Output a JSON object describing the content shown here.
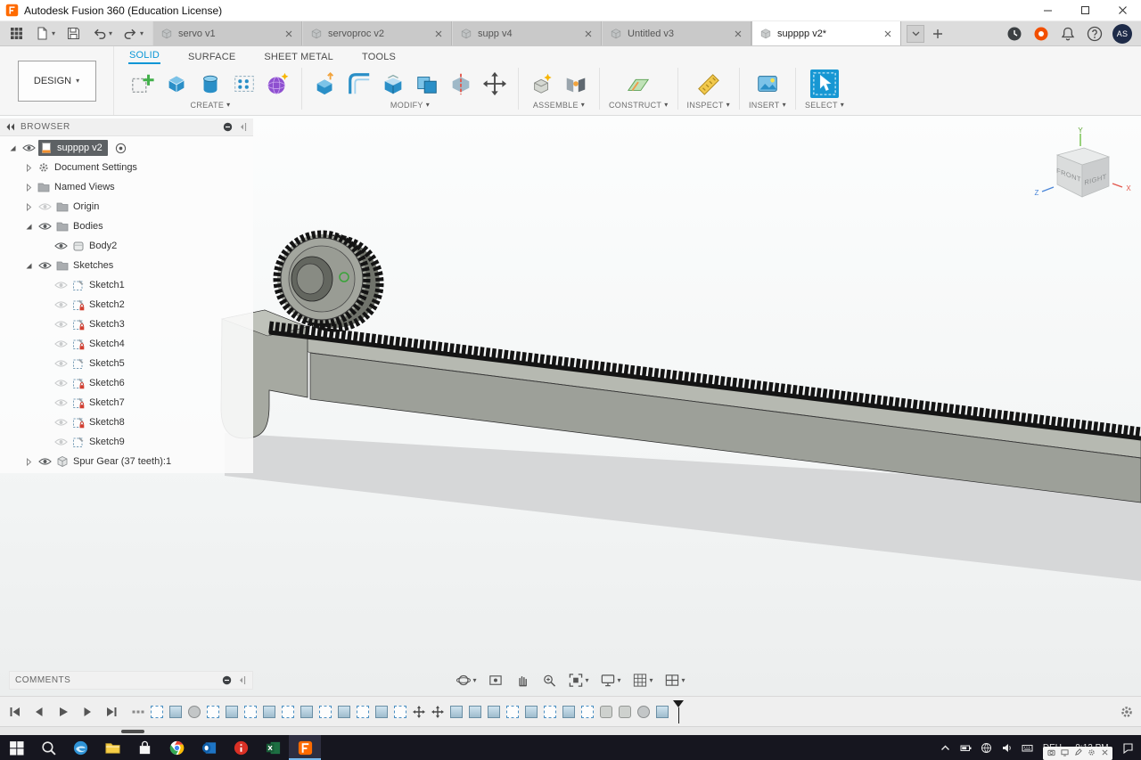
{
  "titlebar": {
    "title": "Autodesk Fusion 360 (Education License)"
  },
  "doc_tabs": [
    {
      "label": "servo v1",
      "active": false
    },
    {
      "label": "servoproc v2",
      "active": false
    },
    {
      "label": "supp v4",
      "active": false
    },
    {
      "label": "Untitled v3",
      "active": false
    },
    {
      "label": "supppp v2*",
      "active": true
    }
  ],
  "account": {
    "avatar_initials": "AS"
  },
  "ribbon": {
    "design_label": "DESIGN",
    "tabs": [
      {
        "label": "SOLID",
        "active": true
      },
      {
        "label": "SURFACE",
        "active": false
      },
      {
        "label": "SHEET METAL",
        "active": false
      },
      {
        "label": "TOOLS",
        "active": false
      }
    ],
    "groups": [
      {
        "label": "CREATE",
        "icons": [
          "create-sketch",
          "box",
          "cylinder",
          "pattern",
          "create-form"
        ]
      },
      {
        "label": "MODIFY",
        "icons": [
          "press-pull",
          "fillet",
          "shell",
          "combine",
          "split-body",
          "move"
        ]
      },
      {
        "label": "ASSEMBLE",
        "icons": [
          "new-component",
          "joint"
        ]
      },
      {
        "label": "CONSTRUCT",
        "icons": [
          "construction-plane"
        ]
      },
      {
        "label": "INSPECT",
        "icons": [
          "measure"
        ]
      },
      {
        "label": "INSERT",
        "icons": [
          "insert-image"
        ]
      },
      {
        "label": "SELECT",
        "icons": [
          "select-cursor"
        ]
      }
    ]
  },
  "browser": {
    "header": "BROWSER",
    "rows": [
      {
        "label": "supppp v2",
        "level": 0,
        "icon": "document",
        "eye": "on",
        "expander": "expanded",
        "selected": true,
        "trailing": "revision-dot"
      },
      {
        "label": "Document Settings",
        "level": 1,
        "icon": "gear",
        "eye": "none",
        "expander": "collapsed",
        "selected": false
      },
      {
        "label": "Named Views",
        "level": 1,
        "icon": "folder",
        "eye": "none",
        "expander": "collapsed",
        "selected": false
      },
      {
        "label": "Origin",
        "level": 1,
        "icon": "folder",
        "eye": "off",
        "expander": "collapsed",
        "selected": false
      },
      {
        "label": "Bodies",
        "level": 1,
        "icon": "folder",
        "eye": "on",
        "expander": "expanded",
        "selected": false
      },
      {
        "label": "Body2",
        "level": 2,
        "icon": "body",
        "eye": "on",
        "expander": "none",
        "selected": false
      },
      {
        "label": "Sketches",
        "level": 1,
        "icon": "folder",
        "eye": "on",
        "expander": "expanded",
        "selected": false
      },
      {
        "label": "Sketch1",
        "level": 2,
        "icon": "sketch",
        "eye": "off",
        "expander": "none",
        "selected": false
      },
      {
        "label": "Sketch2",
        "level": 2,
        "icon": "sketch-locked",
        "eye": "off",
        "expander": "none",
        "selected": false
      },
      {
        "label": "Sketch3",
        "level": 2,
        "icon": "sketch-locked",
        "eye": "off",
        "expander": "none",
        "selected": false
      },
      {
        "label": "Sketch4",
        "level": 2,
        "icon": "sketch-locked",
        "eye": "off",
        "expander": "none",
        "selected": false
      },
      {
        "label": "Sketch5",
        "level": 2,
        "icon": "sketch",
        "eye": "off",
        "expander": "none",
        "selected": false
      },
      {
        "label": "Sketch6",
        "level": 2,
        "icon": "sketch-locked",
        "eye": "off",
        "expander": "none",
        "selected": false
      },
      {
        "label": "Sketch7",
        "level": 2,
        "icon": "sketch-locked",
        "eye": "off",
        "expander": "none",
        "selected": false
      },
      {
        "label": "Sketch8",
        "level": 2,
        "icon": "sketch-locked",
        "eye": "off",
        "expander": "none",
        "selected": false
      },
      {
        "label": "Sketch9",
        "level": 2,
        "icon": "sketch",
        "eye": "off",
        "expander": "none",
        "selected": false
      },
      {
        "label": "Spur Gear (37 teeth):1",
        "level": 1,
        "icon": "component",
        "eye": "on",
        "expander": "collapsed",
        "selected": false
      }
    ]
  },
  "viewcube": {
    "front_label": "FRONT",
    "right_label": "RIGHT",
    "axis_x": "X",
    "axis_y": "Y",
    "axis_z": "Z"
  },
  "comments_panel": {
    "label": "COMMENTS"
  },
  "navbar": {
    "items": [
      {
        "icon": "orbit",
        "caret": true
      },
      {
        "icon": "look-at",
        "caret": false
      },
      {
        "icon": "pan",
        "caret": false
      },
      {
        "icon": "zoom",
        "caret": false
      },
      {
        "icon": "fit",
        "caret": true
      },
      {
        "icon": "display-settings",
        "caret": true
      },
      {
        "icon": "grid-settings",
        "caret": true
      },
      {
        "icon": "viewports",
        "caret": true
      }
    ]
  },
  "timeline": {
    "playback": [
      "skip-start",
      "step-back",
      "play",
      "step-forward",
      "skip-end"
    ],
    "features": [
      "dots",
      "sketch",
      "extrude",
      "circle",
      "sketch",
      "extrude",
      "sketch",
      "extrude",
      "sketch",
      "extrude",
      "sketch",
      "extrude",
      "sketch",
      "extrude",
      "sketch",
      "move",
      "move",
      "extrude",
      "extrude",
      "extrude",
      "sketch",
      "extrude",
      "sketch",
      "extrude",
      "sketch",
      "cylinder",
      "cylinder",
      "circle",
      "extrude"
    ]
  },
  "taskbar": {
    "apps": [
      {
        "name": "start",
        "active": false
      },
      {
        "name": "search",
        "active": false
      },
      {
        "name": "edge",
        "active": false
      },
      {
        "name": "explorer",
        "active": false
      },
      {
        "name": "store",
        "active": false
      },
      {
        "name": "chrome",
        "active": false
      },
      {
        "name": "outlook",
        "active": false
      },
      {
        "name": "info",
        "active": false
      },
      {
        "name": "excel",
        "active": false
      },
      {
        "name": "fusion",
        "active": true
      }
    ],
    "tray_icons": [
      "chevron-up",
      "battery",
      "globe",
      "speaker",
      "keyboard"
    ],
    "language": "DEU",
    "time": "9:12 PM",
    "overlay_icons": [
      "camera",
      "display",
      "pen",
      "gear",
      "close"
    ]
  }
}
